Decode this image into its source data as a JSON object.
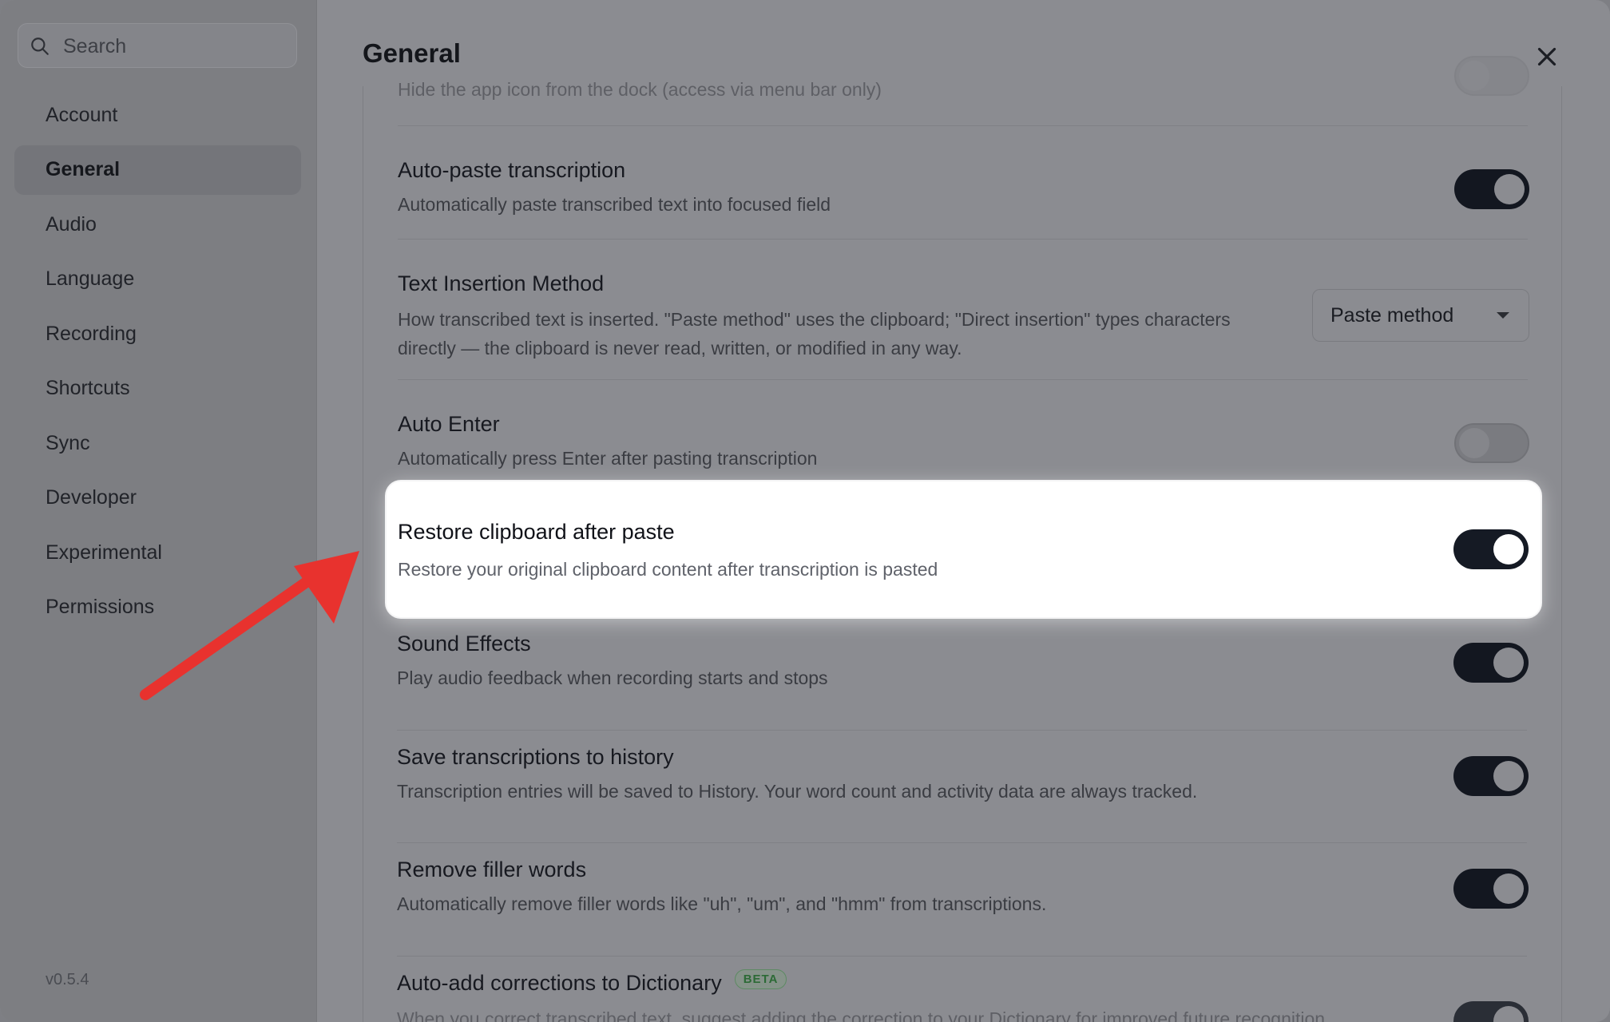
{
  "sidebar": {
    "search_placeholder": "Search",
    "items": [
      {
        "label": "Account"
      },
      {
        "label": "General",
        "active": true
      },
      {
        "label": "Audio"
      },
      {
        "label": "Language"
      },
      {
        "label": "Recording"
      },
      {
        "label": "Shortcuts"
      },
      {
        "label": "Sync"
      },
      {
        "label": "Developer"
      },
      {
        "label": "Experimental"
      },
      {
        "label": "Permissions"
      }
    ],
    "version": "v0.5.4"
  },
  "main": {
    "title": "General",
    "settings": [
      {
        "desc": "Hide the app icon from the dock (access via menu bar only)"
      },
      {
        "title": "Auto-paste transcription",
        "desc": "Automatically paste transcribed text into focused field",
        "state": "on"
      },
      {
        "title": "Text Insertion Method",
        "desc": "How transcribed text is inserted. \"Paste method\" uses the clipboard; \"Direct insertion\" types characters directly — the clipboard is never read, written, or modified in any way.",
        "select_value": "Paste method"
      },
      {
        "title": "Auto Enter",
        "desc": "Automatically press Enter after pasting transcription",
        "state": "off"
      },
      {
        "title": "Restore clipboard after paste",
        "desc": "Restore your original clipboard content after transcription is pasted",
        "state": "on"
      },
      {
        "title": "Sound Effects",
        "desc": "Play audio feedback when recording starts and stops",
        "state": "on"
      },
      {
        "title": "Save transcriptions to history",
        "desc": "Transcription entries will be saved to History. Your word count and activity data are always tracked.",
        "state": "on"
      },
      {
        "title": "Remove filler words",
        "desc": "Automatically remove filler words like \"uh\", \"um\", and \"hmm\" from transcriptions.",
        "state": "on"
      },
      {
        "title": "Auto-add corrections to Dictionary",
        "badge": "BETA",
        "desc": "When you correct transcribed text, suggest adding the correction to your Dictionary for improved future recognition.",
        "state": "on"
      }
    ]
  },
  "annotation": {
    "arrow_color": "#e8322e"
  }
}
